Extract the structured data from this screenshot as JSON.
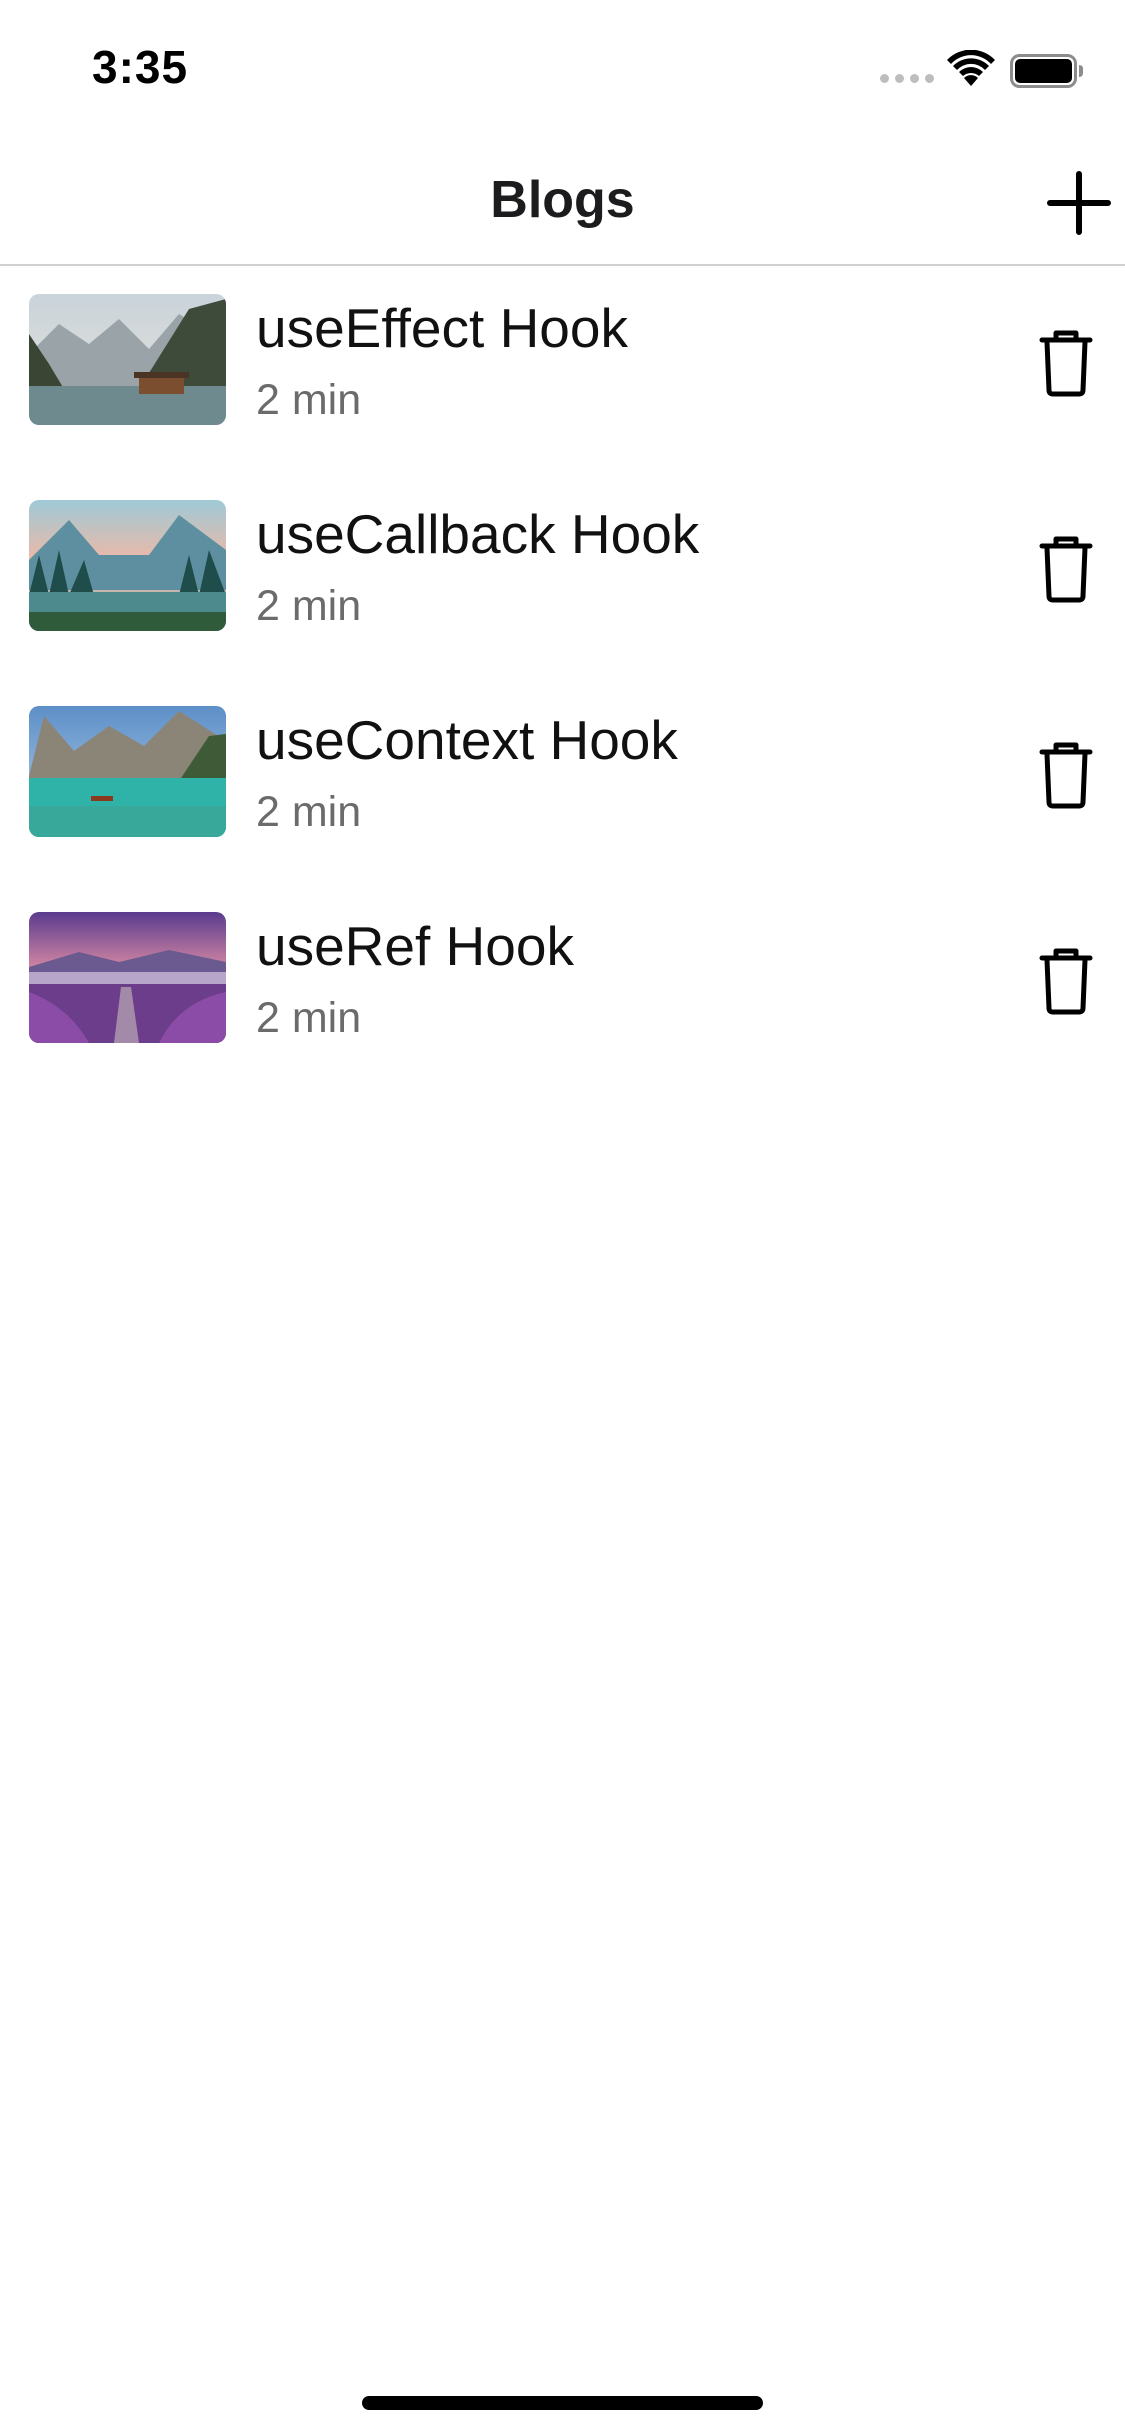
{
  "status_bar": {
    "time": "3:35"
  },
  "nav": {
    "title": "Blogs",
    "add_icon": "plus-icon"
  },
  "blogs": [
    {
      "title": "useEffect Hook",
      "meta": "2 min",
      "image": "mountain-lake-cabin",
      "delete_icon": "trash-icon"
    },
    {
      "title": "useCallback Hook",
      "meta": "2 min",
      "image": "forest-valley-sunset",
      "delete_icon": "trash-icon"
    },
    {
      "title": "useContext Hook",
      "meta": "2 min",
      "image": "turquoise-lake-boat",
      "delete_icon": "trash-icon"
    },
    {
      "title": "useRef Hook",
      "meta": "2 min",
      "image": "lavender-field-sunset",
      "delete_icon": "trash-icon"
    }
  ],
  "colors": {
    "separator": "#d0d0d3",
    "meta_text": "#6b6b6b",
    "background": "#ffffff"
  }
}
